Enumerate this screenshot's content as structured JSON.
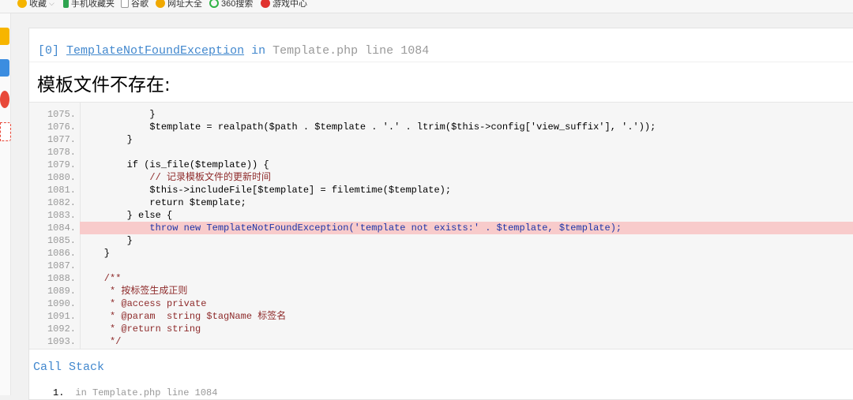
{
  "bookmarks": [
    {
      "label": "收藏",
      "icon": "star-icon",
      "color": "#f5b400"
    },
    {
      "label": "手机收藏夹",
      "icon": "phone-icon",
      "color": "#2ea44f"
    },
    {
      "label": "谷歌",
      "icon": "page-icon",
      "color": "#888888"
    },
    {
      "label": "网址大全",
      "icon": "plus-icon",
      "color": "#f0a800"
    },
    {
      "label": "360搜索",
      "icon": "360-icon",
      "color": "#2fb344"
    },
    {
      "label": "游戏中心",
      "icon": "game-icon",
      "color": "#e0322e"
    }
  ],
  "exception": {
    "index": "[0]",
    "class": "TemplateNotFoundException",
    "in": "in",
    "file": "Template.php",
    "line_word": "line",
    "line": "1084",
    "message": "模板文件不存在:"
  },
  "source_lines": [
    {
      "n": "1075.",
      "code": "            }"
    },
    {
      "n": "1076.",
      "code": "            $template = realpath($path . $template . '.' . ltrim($this->config['view_suffix'], '.'));"
    },
    {
      "n": "1077.",
      "code": "        }"
    },
    {
      "n": "1078.",
      "code": ""
    },
    {
      "n": "1079.",
      "code": "        if (is_file($template)) {"
    },
    {
      "n": "1080.",
      "code": "            // 记录模板文件的更新时间"
    },
    {
      "n": "1081.",
      "code": "            $this->includeFile[$template] = filemtime($template);"
    },
    {
      "n": "1082.",
      "code": "            return $template;"
    },
    {
      "n": "1083.",
      "code": "        } else {"
    },
    {
      "n": "1084.",
      "code": "            throw new TemplateNotFoundException('template not exists:' . $template, $template);"
    },
    {
      "n": "1085.",
      "code": "        }"
    },
    {
      "n": "1086.",
      "code": "    }"
    },
    {
      "n": "1087.",
      "code": ""
    },
    {
      "n": "1088.",
      "code": "    /**"
    },
    {
      "n": "1089.",
      "code": "     * 按标签生成正则"
    },
    {
      "n": "1090.",
      "code": "     * @access private"
    },
    {
      "n": "1091.",
      "code": "     * @param  string $tagName 标签名"
    },
    {
      "n": "1092.",
      "code": "     * @return string"
    },
    {
      "n": "1093.",
      "code": "     */"
    }
  ],
  "highlight_line": "1084.",
  "call_stack": {
    "title": "Call Stack",
    "entries": [
      {
        "num": "1.",
        "text": "in Template.php line 1084"
      }
    ]
  },
  "colors": {
    "link_blue": "#4288ce",
    "highlight_bg": "#f8cbcb"
  }
}
